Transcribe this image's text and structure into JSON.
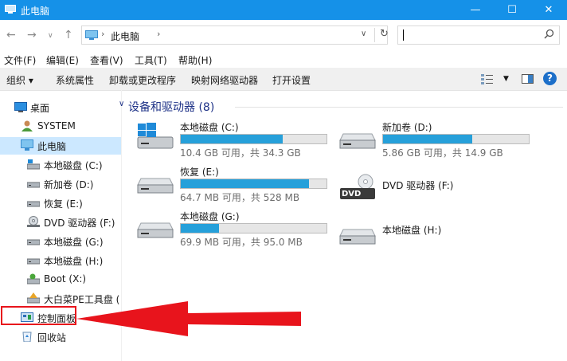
{
  "window": {
    "title": "此电脑",
    "minimize": "—",
    "maximize": "☐",
    "close": "✕"
  },
  "address": {
    "path": "此电脑",
    "sep": "›",
    "dropdown": "∨",
    "refresh": "↻",
    "search_placeholder": ""
  },
  "nav": {
    "back": "←",
    "forward": "→",
    "recent": "∨",
    "up": "↑"
  },
  "menu": [
    "文件(F)",
    "编辑(E)",
    "查看(V)",
    "工具(T)",
    "帮助(H)"
  ],
  "toolbar": {
    "organize": "组织 ▾",
    "items": [
      "系统属性",
      "卸载或更改程序",
      "映射网络驱动器",
      "打开设置"
    ],
    "view_drop": "▼",
    "help": "?"
  },
  "sidebar": {
    "items": [
      {
        "label": "桌面",
        "icon": "desktop-icon"
      },
      {
        "label": "SYSTEM",
        "icon": "user-icon"
      },
      {
        "label": "此电脑",
        "icon": "computer-icon",
        "selected": true
      },
      {
        "label": "本地磁盘 (C:)",
        "icon": "system-drive-icon"
      },
      {
        "label": "新加卷 (D:)",
        "icon": "drive-icon"
      },
      {
        "label": "恢复 (E:)",
        "icon": "drive-icon"
      },
      {
        "label": "DVD 驱动器 (F:)",
        "icon": "dvd-drive-icon"
      },
      {
        "label": "本地磁盘 (G:)",
        "icon": "drive-icon"
      },
      {
        "label": "本地磁盘 (H:)",
        "icon": "drive-icon"
      },
      {
        "label": "Boot (X:)",
        "icon": "boot-drive-icon"
      },
      {
        "label": "大白菜PE工具盘 (",
        "icon": "pe-drive-icon"
      },
      {
        "label": "控制面板",
        "icon": "control-panel-icon"
      },
      {
        "label": "回收站",
        "icon": "recycle-bin-icon"
      }
    ]
  },
  "content": {
    "chevron": "∨",
    "section_title": "设备和驱动器 (8)",
    "drives": [
      {
        "name": "本地磁盘 (C:)",
        "info": "10.4 GB 可用，共 34.3 GB",
        "used_fraction": 0.7,
        "icon": "windows-drive-icon"
      },
      {
        "name": "新加卷 (D:)",
        "info": "5.86 GB 可用，共 14.9 GB",
        "used_fraction": 0.61,
        "icon": "drive-icon"
      },
      {
        "name": "恢复 (E:)",
        "info": "64.7 MB 可用，共 528 MB",
        "used_fraction": 0.88,
        "icon": "drive-icon"
      },
      {
        "name": "DVD 驱动器 (F:)",
        "info": "",
        "used_fraction": null,
        "icon": "dvd-drive-icon"
      },
      {
        "name": "本地磁盘 (G:)",
        "info": "69.9 MB 可用，共 95.0 MB",
        "used_fraction": 0.26,
        "icon": "drive-icon"
      },
      {
        "name": "本地磁盘 (H:)",
        "info": "",
        "used_fraction": null,
        "icon": "drive-icon"
      }
    ],
    "dvd_badge": "DVD"
  },
  "colors": {
    "titlebar": "#1591e8",
    "accent": "#26a0da",
    "highlight": "#e8141c"
  }
}
